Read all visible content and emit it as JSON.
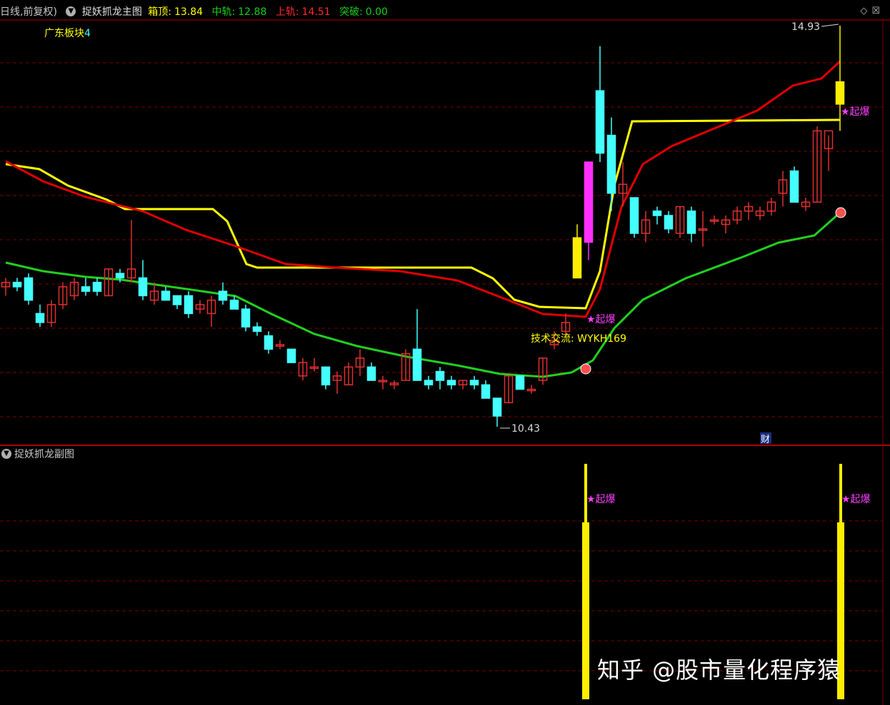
{
  "header": {
    "period_label": "日线,前复权)",
    "main_indicator": "捉妖抓龙主图",
    "box_top_label": "箱顶:",
    "box_top_value": "13.84",
    "mid_rail_label": "中轨:",
    "mid_rail_value": "12.88",
    "upper_rail_label": "上轨:",
    "upper_rail_value": "14.51",
    "breakout_label": "突破:",
    "breakout_value": "0.00"
  },
  "top_right_icons": [
    "restore-icon",
    "close-icon"
  ],
  "sector_label": "广东板块",
  "sector_count": "4",
  "sub_indicator": "捉妖抓龙副图",
  "annotations": {
    "high_price": "14.93",
    "low_price": "10.43",
    "signal": "★起爆",
    "contact": "技术交流: WYKH169",
    "finance_icon": "财"
  },
  "watermark": "知乎 @股市量化程序猿",
  "colors": {
    "background": "#000000",
    "up_candle": "#e03030",
    "down_candle": "#44ffff",
    "box_top_line": "#ffff00",
    "upper_rail": "#e00000",
    "mid_rail": "#20d020",
    "signal_text": "#ff40ff",
    "grid": "#7a0000"
  },
  "chart_data": {
    "type": "candlestick",
    "ohlc_approx": [
      [
        12.0,
        12.1,
        11.9,
        12.05
      ],
      [
        12.05,
        12.1,
        11.95,
        12.0
      ],
      [
        12.1,
        12.15,
        11.8,
        11.85
      ],
      [
        11.7,
        11.8,
        11.55,
        11.6
      ],
      [
        11.6,
        11.85,
        11.55,
        11.8
      ],
      [
        11.8,
        12.05,
        11.75,
        12.0
      ],
      [
        11.9,
        12.1,
        11.85,
        12.05
      ],
      [
        12.0,
        12.1,
        11.9,
        11.95
      ],
      [
        12.05,
        12.1,
        11.9,
        11.95
      ],
      [
        11.9,
        12.2,
        11.9,
        12.2
      ],
      [
        12.15,
        12.2,
        12.05,
        12.1
      ],
      [
        12.1,
        12.75,
        12.05,
        12.2
      ],
      [
        12.1,
        12.3,
        11.85,
        11.9
      ],
      [
        11.85,
        12.05,
        11.8,
        11.95
      ],
      [
        11.95,
        12.0,
        11.85,
        11.85
      ],
      [
        11.9,
        11.9,
        11.75,
        11.8
      ],
      [
        11.9,
        11.95,
        11.65,
        11.7
      ],
      [
        11.75,
        11.85,
        11.7,
        11.8
      ],
      [
        11.7,
        11.9,
        11.55,
        11.85
      ],
      [
        11.95,
        12.05,
        11.8,
        11.85
      ],
      [
        11.85,
        11.9,
        11.75,
        11.75
      ],
      [
        11.75,
        11.8,
        11.5,
        11.55
      ],
      [
        11.55,
        11.6,
        11.45,
        11.5
      ],
      [
        11.45,
        11.5,
        11.25,
        11.3
      ],
      [
        11.35,
        11.4,
        11.3,
        11.35
      ],
      [
        11.3,
        11.3,
        11.15,
        11.15
      ],
      [
        11.0,
        11.2,
        10.95,
        11.15
      ],
      [
        11.1,
        11.2,
        11.05,
        11.1
      ],
      [
        11.1,
        11.1,
        10.85,
        10.9
      ],
      [
        10.95,
        11.05,
        10.8,
        11.0
      ],
      [
        10.9,
        11.15,
        10.9,
        11.1
      ],
      [
        11.1,
        11.3,
        11.0,
        11.2
      ],
      [
        11.1,
        11.15,
        10.95,
        10.95
      ],
      [
        10.95,
        11.0,
        10.85,
        10.95
      ],
      [
        10.9,
        10.95,
        10.85,
        10.92
      ],
      [
        10.95,
        11.3,
        10.95,
        11.25
      ],
      [
        11.3,
        11.75,
        10.95,
        10.95
      ],
      [
        10.95,
        11.0,
        10.85,
        10.9
      ],
      [
        11.05,
        11.1,
        10.85,
        10.95
      ],
      [
        10.95,
        11.0,
        10.85,
        10.9
      ],
      [
        10.9,
        10.95,
        10.85,
        10.95
      ],
      [
        10.95,
        11.0,
        10.85,
        10.9
      ],
      [
        10.9,
        10.95,
        10.75,
        10.75
      ],
      [
        10.75,
        10.75,
        10.43,
        10.55
      ],
      [
        10.7,
        11.0,
        10.7,
        11.0
      ],
      [
        11.0,
        11.0,
        10.85,
        10.85
      ],
      [
        10.85,
        10.9,
        10.8,
        10.85
      ],
      [
        10.95,
        11.2,
        10.9,
        11.2
      ],
      [
        11.35,
        11.5,
        11.3,
        11.4
      ],
      [
        11.5,
        11.7,
        11.45,
        11.6
      ],
      [
        12.55,
        12.7,
        12.1,
        12.1
      ],
      [
        12.5,
        13.4,
        12.3,
        13.4
      ],
      [
        14.2,
        14.7,
        13.4,
        13.5
      ],
      [
        13.7,
        13.9,
        12.85,
        13.05
      ],
      [
        13.05,
        13.4,
        12.9,
        13.15
      ],
      [
        13.0,
        13.0,
        12.55,
        12.6
      ],
      [
        12.6,
        12.85,
        12.5,
        12.75
      ],
      [
        12.85,
        12.9,
        12.7,
        12.8
      ],
      [
        12.8,
        12.85,
        12.6,
        12.65
      ],
      [
        12.6,
        12.9,
        12.55,
        12.9
      ],
      [
        12.85,
        12.9,
        12.5,
        12.6
      ],
      [
        12.65,
        12.85,
        12.45,
        12.65
      ],
      [
        12.75,
        12.8,
        12.7,
        12.75
      ],
      [
        12.7,
        12.8,
        12.6,
        12.75
      ],
      [
        12.75,
        12.9,
        12.7,
        12.85
      ],
      [
        12.85,
        12.95,
        12.75,
        12.9
      ],
      [
        12.8,
        12.9,
        12.75,
        12.85
      ],
      [
        12.85,
        13.0,
        12.8,
        12.95
      ],
      [
        13.05,
        13.3,
        12.9,
        13.2
      ],
      [
        13.3,
        13.35,
        12.95,
        12.95
      ],
      [
        12.9,
        13.0,
        12.85,
        12.95
      ],
      [
        12.95,
        13.8,
        12.95,
        13.75
      ],
      [
        13.55,
        13.7,
        13.3,
        13.75
      ],
      [
        14.05,
        14.93,
        13.75,
        14.3
      ]
    ],
    "high_marker": 14.93,
    "low_marker": 10.43
  }
}
